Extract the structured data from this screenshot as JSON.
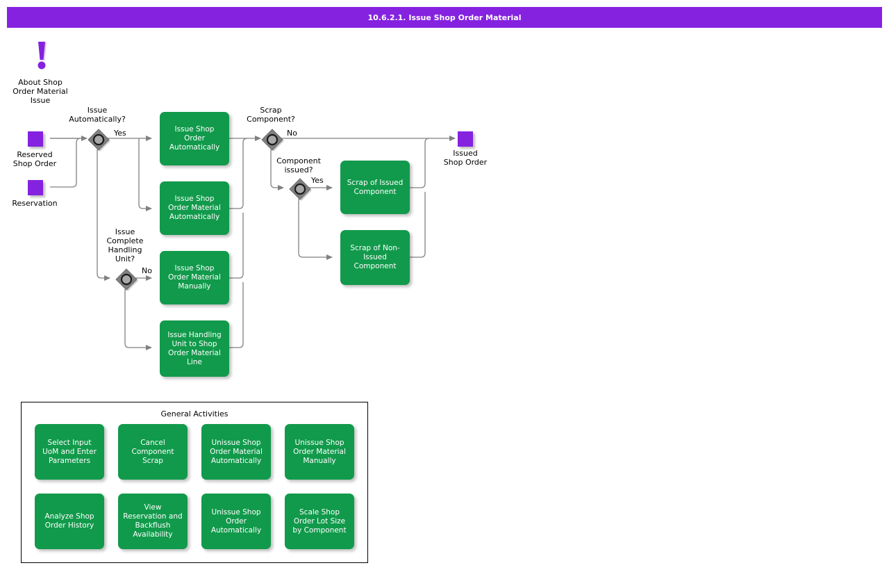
{
  "titlebar": {
    "title": "10.6.2.1. Issue Shop Order Material",
    "bg_color": "#8522e0",
    "text_color": "#ffffff"
  },
  "colors": {
    "process_green": "#119a4b",
    "object_purple": "#8522e0",
    "gateway_gray": "#808080",
    "line_gray": "#808080"
  },
  "note": {
    "icon": "exclamation-icon",
    "label": "About Shop\nOrder Material\nIssue"
  },
  "objects": [
    {
      "name": "reserved-shop-order",
      "label": "Reserved\nShop Order"
    },
    {
      "name": "reservation",
      "label": "Reservation"
    },
    {
      "name": "issued-shop-order",
      "label": "Issued\nShop Order"
    }
  ],
  "gateways": [
    {
      "name": "issue-automatically",
      "label": "Issue\nAutomatically?",
      "branch": "Yes"
    },
    {
      "name": "issue-complete-handling-unit",
      "label": "Issue\nComplete\nHandling\nUnit?",
      "branch": "No"
    },
    {
      "name": "scrap-component",
      "label": "Scrap\nComponent?",
      "branch": "No"
    },
    {
      "name": "component-issued",
      "label": "Component\nissued?",
      "branch": "Yes"
    }
  ],
  "processes": [
    {
      "name": "issue-shop-order-automatically",
      "label": "Issue Shop\nOrder\nAutomatically"
    },
    {
      "name": "issue-shop-order-material-automatically",
      "label": "Issue Shop\nOrder Material\nAutomatically"
    },
    {
      "name": "issue-shop-order-material-manually",
      "label": "Issue Shop\nOrder Material\nManually"
    },
    {
      "name": "issue-handling-unit-to-shop-order-material-line",
      "label": "Issue Handling\nUnit to Shop\nOrder Material\nLine"
    },
    {
      "name": "scrap-of-issued-component",
      "label": "Scrap of Issued\nComponent"
    },
    {
      "name": "scrap-of-non-issued-component",
      "label": "Scrap of Non-\nIssued\nComponent"
    }
  ],
  "general_activities": {
    "title": "General Activities",
    "items": [
      {
        "name": "select-input-uom-and-enter-parameters",
        "label": "Select Input\nUoM and Enter\nParameters"
      },
      {
        "name": "cancel-component-scrap",
        "label": "Cancel\nComponent\nScrap"
      },
      {
        "name": "unissue-shop-order-material-automatically",
        "label": "Unissue Shop\nOrder Material\nAutomatically"
      },
      {
        "name": "unissue-shop-order-material-manually",
        "label": "Unissue Shop\nOrder Material\nManually"
      },
      {
        "name": "analyze-shop-order-history",
        "label": "Analyze Shop\nOrder History"
      },
      {
        "name": "view-reservation-and-backflush-availability",
        "label": "View\nReservation and\nBackflush\nAvailability"
      },
      {
        "name": "unissue-shop-order-automatically",
        "label": "Unissue Shop\nOrder\nAutomatically"
      },
      {
        "name": "scale-shop-order-lot-size-by-component",
        "label": "Scale Shop\nOrder Lot Size\nby Component"
      }
    ]
  }
}
